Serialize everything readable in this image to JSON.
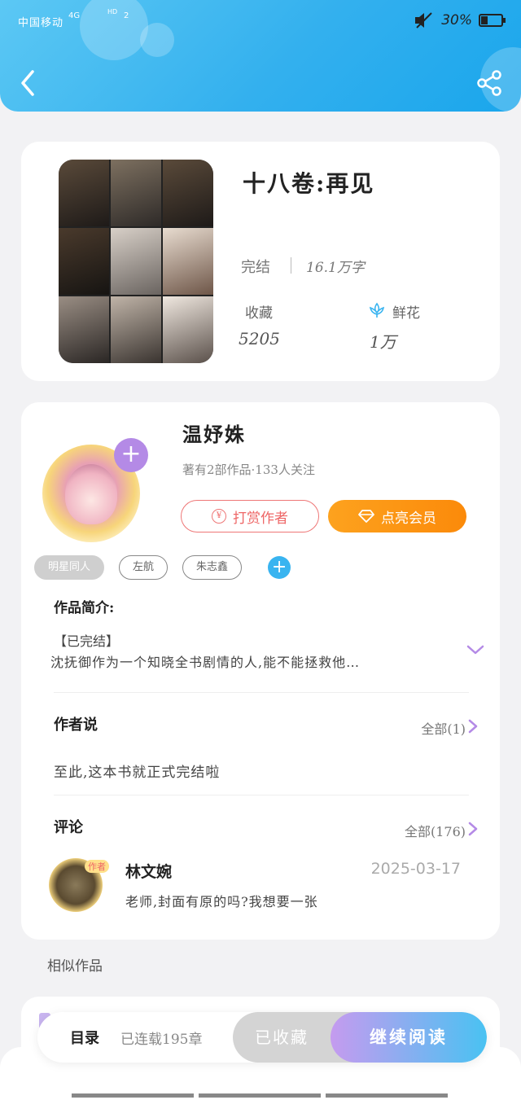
{
  "status_bar": {
    "carrier": "中国移动",
    "network": "4G",
    "hd": "HD",
    "wifi": "2",
    "battery_pct": "30%",
    "battery_level": 0.3
  },
  "nav": {
    "back_icon": "chevron-left-icon",
    "share_icon": "share-icon"
  },
  "book": {
    "title": "十八卷:再见",
    "status": "完结",
    "word_count": "16.1万字",
    "favorites_label": "收藏",
    "favorites_value": "5205",
    "flowers_label": "鲜花",
    "flowers_value": "1万"
  },
  "author": {
    "name": "温妤姝",
    "stats": "著有2部作品·133人关注",
    "tip_label": "打赏作者",
    "vip_label": "点亮会员"
  },
  "tags": [
    "明星同人",
    "左航",
    "朱志鑫"
  ],
  "intro": {
    "label": "作品简介:",
    "status": "【已完结】",
    "text": "沈抚御作为一个知晓全书剧情的人,能不能拯救他…"
  },
  "author_says": {
    "title": "作者说",
    "more": "全部(1)",
    "text": "至此,这本书就正式完结啦"
  },
  "comments": {
    "title": "评论",
    "more": "全部(176)",
    "items": [
      {
        "name": "林文婉",
        "badge": "作者",
        "date": "2025-03-17",
        "text": "老师,封面有原的吗?我想要一张"
      }
    ]
  },
  "similar": {
    "title": "相似作品"
  },
  "action_bar": {
    "toc_label": "目录",
    "chapters_label": "已连载195章",
    "collected_label": "已收藏",
    "read_label": "继续阅读"
  },
  "colors": {
    "header_start": "#5cc8f4",
    "header_end": "#1aa6ec",
    "accent_orange": "#fb8a0a",
    "accent_purple": "#b48ae6",
    "accent_blue": "#39b4f0",
    "tip_red": "#e66666"
  }
}
